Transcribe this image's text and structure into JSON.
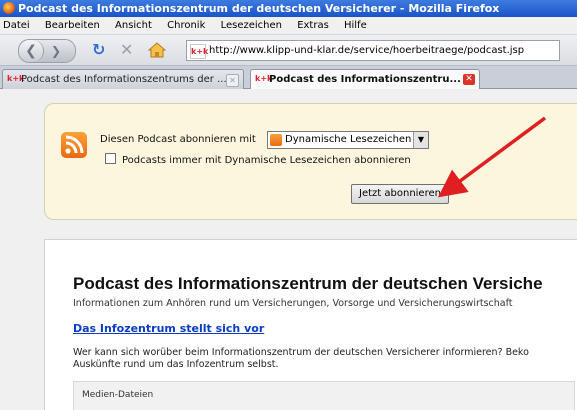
{
  "window": {
    "title": "Podcast des Informationszentrum der deutschen Versicherer - Mozilla Firefox"
  },
  "menu": [
    "Datei",
    "Bearbeiten",
    "Ansicht",
    "Chronik",
    "Lesezeichen",
    "Extras",
    "Hilfe"
  ],
  "navigation": {
    "url": "http://www.klipp-und-klar.de/service/hoerbeitraege/podcast.jsp"
  },
  "tabs": [
    {
      "label": "Podcast des Informationszentrums der ...",
      "active": false
    },
    {
      "label": "Podcast des Informationszentru...",
      "active": true
    }
  ],
  "subscribe": {
    "label": "Diesen Podcast abonnieren mit",
    "selected": "Dynamische Lesezeichen",
    "checkbox_label": "Podcasts immer mit Dynamische Lesezeichen abonnieren",
    "button": "Jetzt abonnieren"
  },
  "page": {
    "heading": "Podcast des Informationszentrum der deutschen Versiche",
    "subtitle": "Informationen zum Anhören rund um Versicherungen, Vorsorge und Versicherungswirtschaft",
    "link": "Das Infozentrum stellt sich vor",
    "paragraph": "Wer kann sich worüber beim Informationszentrum der deutschen Versicherer informieren? Beko Auskünfte rund um das Infozentrum selbst.",
    "media_label": "Medien-Dateien"
  },
  "colors": {
    "annotation_arrow": "#e02020",
    "rss_orange": "#f28a1e",
    "link_blue": "#0a3cc6"
  }
}
